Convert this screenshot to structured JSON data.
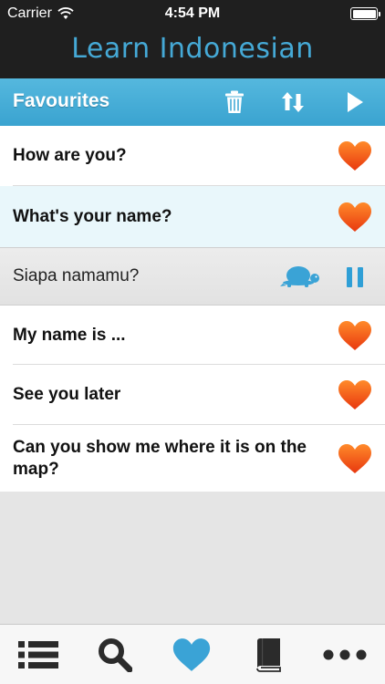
{
  "status_bar": {
    "carrier": "Carrier",
    "time": "4:54 PM"
  },
  "app": {
    "title": "Learn Indonesian"
  },
  "toolbar": {
    "title": "Favourites",
    "icons": [
      "trash-icon",
      "sort-icon",
      "play-icon"
    ]
  },
  "list": {
    "items": [
      {
        "text": "How are you?",
        "favourite": true
      },
      {
        "text": "What's your name?",
        "favourite": true,
        "selected": true
      },
      {
        "text": "Siapa namamu?",
        "playing": true
      },
      {
        "text": "My name is ...",
        "favourite": true
      },
      {
        "text": "See you later",
        "favourite": true
      },
      {
        "text": "Can you show me where it is on the map?",
        "favourite": true
      }
    ]
  },
  "tab_bar": {
    "tabs": [
      {
        "icon": "list-icon",
        "active": false
      },
      {
        "icon": "search-icon",
        "active": false
      },
      {
        "icon": "heart-icon",
        "active": true
      },
      {
        "icon": "book-icon",
        "active": false
      },
      {
        "icon": "more-icon",
        "active": false
      }
    ]
  },
  "colors": {
    "accent": "#45a9d6",
    "toolbar": "#3aa3d0",
    "heart": "#f4571b",
    "dark_bar": "#1f1f1f",
    "tab_icon": "#2b2b2b"
  }
}
